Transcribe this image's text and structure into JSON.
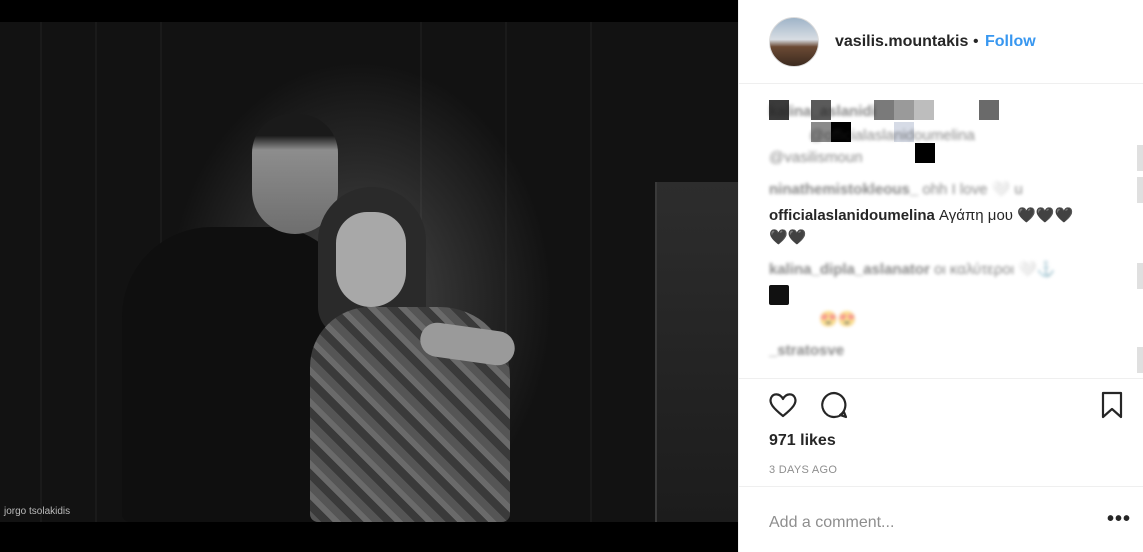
{
  "post": {
    "photo_credit": "jorgo tsolakidis"
  },
  "header": {
    "username": "vasilis.mountakis",
    "separator": "•",
    "follow_label": "Follow"
  },
  "comments": [
    {
      "user": "kalina_aslanidi",
      "text": "",
      "blurred": true
    },
    {
      "user": "",
      "text": "@officialaslanidoumelina",
      "blurred": true
    },
    {
      "user": "",
      "text": "@vasilismoun",
      "blurred": true
    },
    {
      "user": "ninathemistokleous_",
      "text": "ohh I love 🤍 u",
      "blurred": true
    },
    {
      "user": "officialaslanidoumelina",
      "text": "Αγάπη μου 🖤🖤🖤",
      "extra": "🖤🖤",
      "blurred": false
    },
    {
      "user": "kalina_dipla_aslanator",
      "text": "οι καλύτεροι 🤍⚓",
      "blurred": true
    },
    {
      "user": "",
      "text": "😍😍",
      "blurred": true
    },
    {
      "user": "_stratosve",
      "text": "",
      "blurred": true
    }
  ],
  "actions": {
    "like_icon": "heart-icon",
    "comment_icon": "speech-bubble-icon",
    "save_icon": "bookmark-icon"
  },
  "stats": {
    "likes": "971 likes",
    "timestamp": "3 DAYS AGO"
  },
  "add_comment": {
    "placeholder": "Add a comment...",
    "more_label": "•••"
  }
}
